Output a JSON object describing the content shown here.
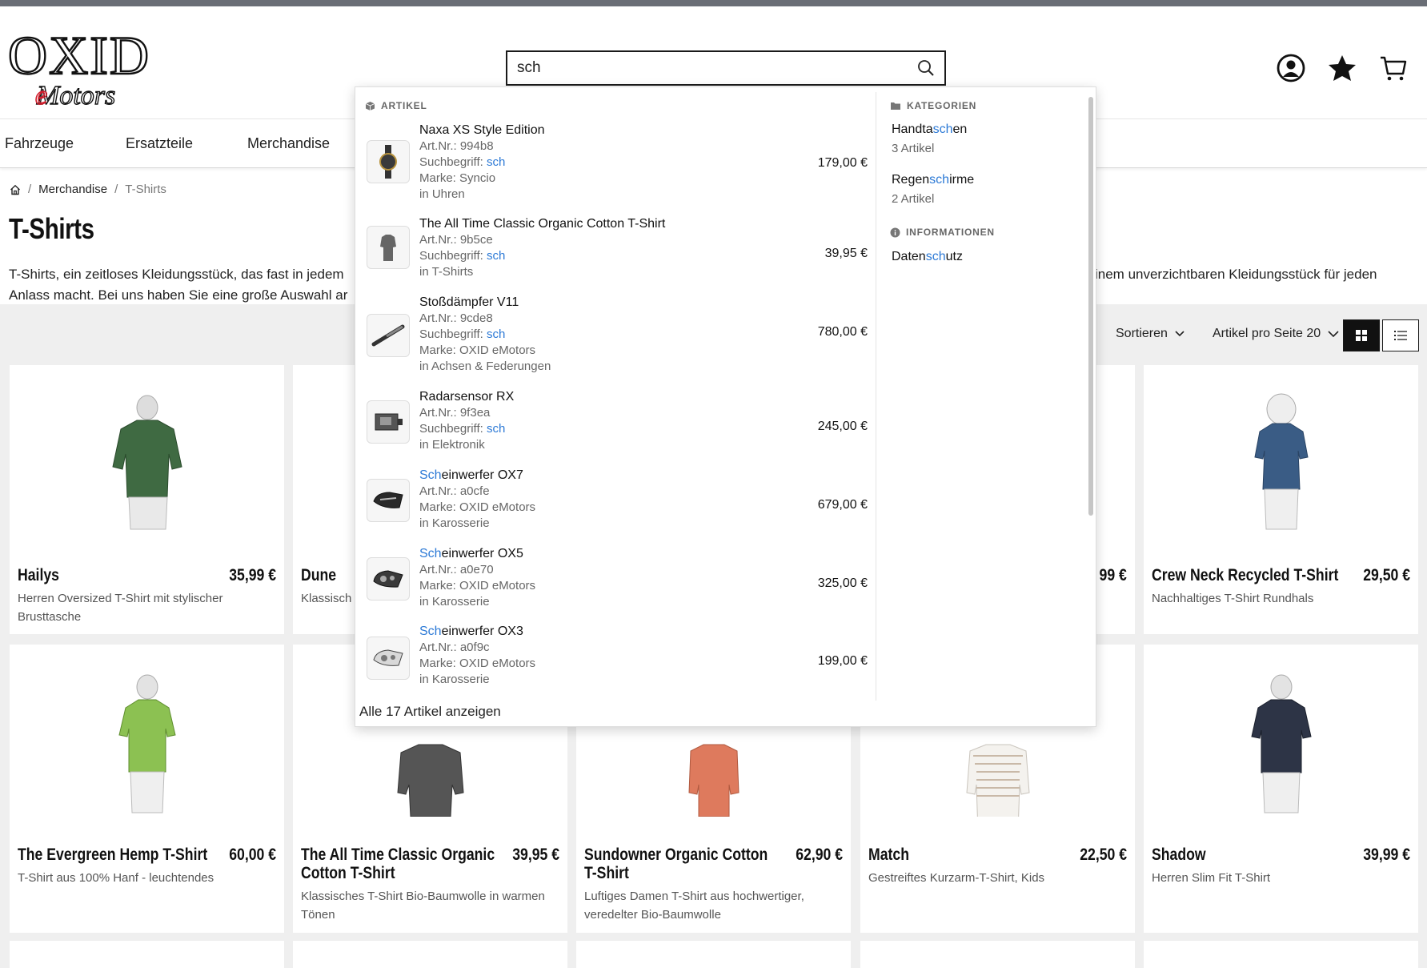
{
  "logo": {
    "top": "OXID",
    "bottom": "eMotors"
  },
  "search": {
    "value": "sch",
    "placeholder": ""
  },
  "nav": {
    "items": [
      "Fahrzeuge",
      "Ersatzteile",
      "Merchandise"
    ]
  },
  "breadcrumb": {
    "items": [
      "Merchandise",
      "T-Shirts"
    ]
  },
  "page": {
    "title": "T-Shirts",
    "intro_line1_left": "T-Shirts, ein zeitloses Kleidungsstück, das fast in jedem",
    "intro_line1_right": "inem unverzichtbaren Kleidungsstück für jeden",
    "intro_line2_left": "Anlass macht. Bei uns haben Sie eine große Auswahl ar"
  },
  "toolbar": {
    "sort_label": "Sortieren",
    "per_page_label": "Artikel pro Seite 20"
  },
  "products": [
    {
      "name": "Hailys",
      "price": "35,99 €",
      "desc": "Herren Oversized T-Shirt mit stylischer Brusttasche"
    },
    {
      "name": "Dune",
      "price": "",
      "desc": "Klassisch"
    },
    {
      "name": "",
      "price": "99 €",
      "desc": ""
    },
    {
      "name": "Crew Neck Recycled T-Shirt",
      "price": "29,50 €",
      "desc": "Nachhaltiges T-Shirt Rundhals"
    },
    {
      "name": "The Evergreen Hemp T-Shirt",
      "price": "60,00 €",
      "desc": "T-Shirt aus 100% Hanf - leuchtendes"
    },
    {
      "name": "The All Time Classic Organic Cotton T-Shirt",
      "price": "39,95 €",
      "desc": "Klassisches T-Shirt Bio-Baumwolle in warmen Tönen"
    },
    {
      "name": "Sundowner Organic Cotton T-Shirt",
      "price": "62,90 €",
      "desc": "Luftiges Damen T-Shirt aus hochwertiger, veredelter Bio-Baumwolle"
    },
    {
      "name": "Match",
      "price": "22,50 €",
      "desc": "Gestreiftes Kurzarm-T-Shirt, Kids"
    },
    {
      "name": "Shadow",
      "price": "39,99 €",
      "desc": "Herren Slim Fit T-Shirt"
    }
  ],
  "dropdown": {
    "articles_heading": "ARTIKEL",
    "categories_heading": "KATEGORIEN",
    "info_heading": "INFORMATIONEN",
    "articles": [
      {
        "title": "Naxa XS Style Edition",
        "artnr": "Art.Nr.: 994b8",
        "term_label": "Suchbegriff: ",
        "term": "sch",
        "brand": "Marke: Syncio",
        "category": "in Uhren",
        "price": "179,00 €"
      },
      {
        "title": "The All Time Classic Organic Cotton T-Shirt",
        "artnr": "Art.Nr.: 9b5ce",
        "term_label": "Suchbegriff: ",
        "term": "sch",
        "brand": "",
        "category": "in T-Shirts",
        "price": "39,95 €"
      },
      {
        "title": "Stoßdämpfer V11",
        "artnr": "Art.Nr.: 9cde8",
        "term_label": "Suchbegriff: ",
        "term": "sch",
        "brand": "Marke: OXID eMotors",
        "category": "in Achsen & Federungen",
        "price": "780,00 €"
      },
      {
        "title": "Radarsensor RX",
        "artnr": "Art.Nr.: 9f3ea",
        "term_label": "Suchbegriff: ",
        "term": "sch",
        "brand": "",
        "category": "in Elektronik",
        "price": "245,00 €"
      },
      {
        "title_hl": "Sch",
        "title_rest": "einwerfer OX7",
        "artnr": "Art.Nr.: a0cfe",
        "brand": "Marke: OXID eMotors",
        "category": "in Karosserie",
        "price": "679,00 €"
      },
      {
        "title_hl": "Sch",
        "title_rest": "einwerfer OX5",
        "artnr": "Art.Nr.: a0e70",
        "brand": "Marke: OXID eMotors",
        "category": "in Karosserie",
        "price": "325,00 €"
      },
      {
        "title_hl": "Sch",
        "title_rest": "einwerfer OX3",
        "artnr": "Art.Nr.: a0f9c",
        "brand": "Marke: OXID eMotors",
        "category": "in Karosserie",
        "price": "199,00 €"
      }
    ],
    "categories": [
      {
        "pre": "Handta",
        "hl": "sch",
        "post": "en",
        "count": "3 Artikel"
      },
      {
        "pre": "Regen",
        "hl": "sch",
        "post": "irme",
        "count": "2 Artikel"
      }
    ],
    "info": [
      {
        "pre": "Daten",
        "hl": "sch",
        "post": "utz"
      }
    ],
    "footer": "Alle 17 Artikel anzeigen"
  },
  "colors": {
    "highlight": "#2d7ad6",
    "topbar": "#6a6e76",
    "logo_red": "#d1202e"
  }
}
